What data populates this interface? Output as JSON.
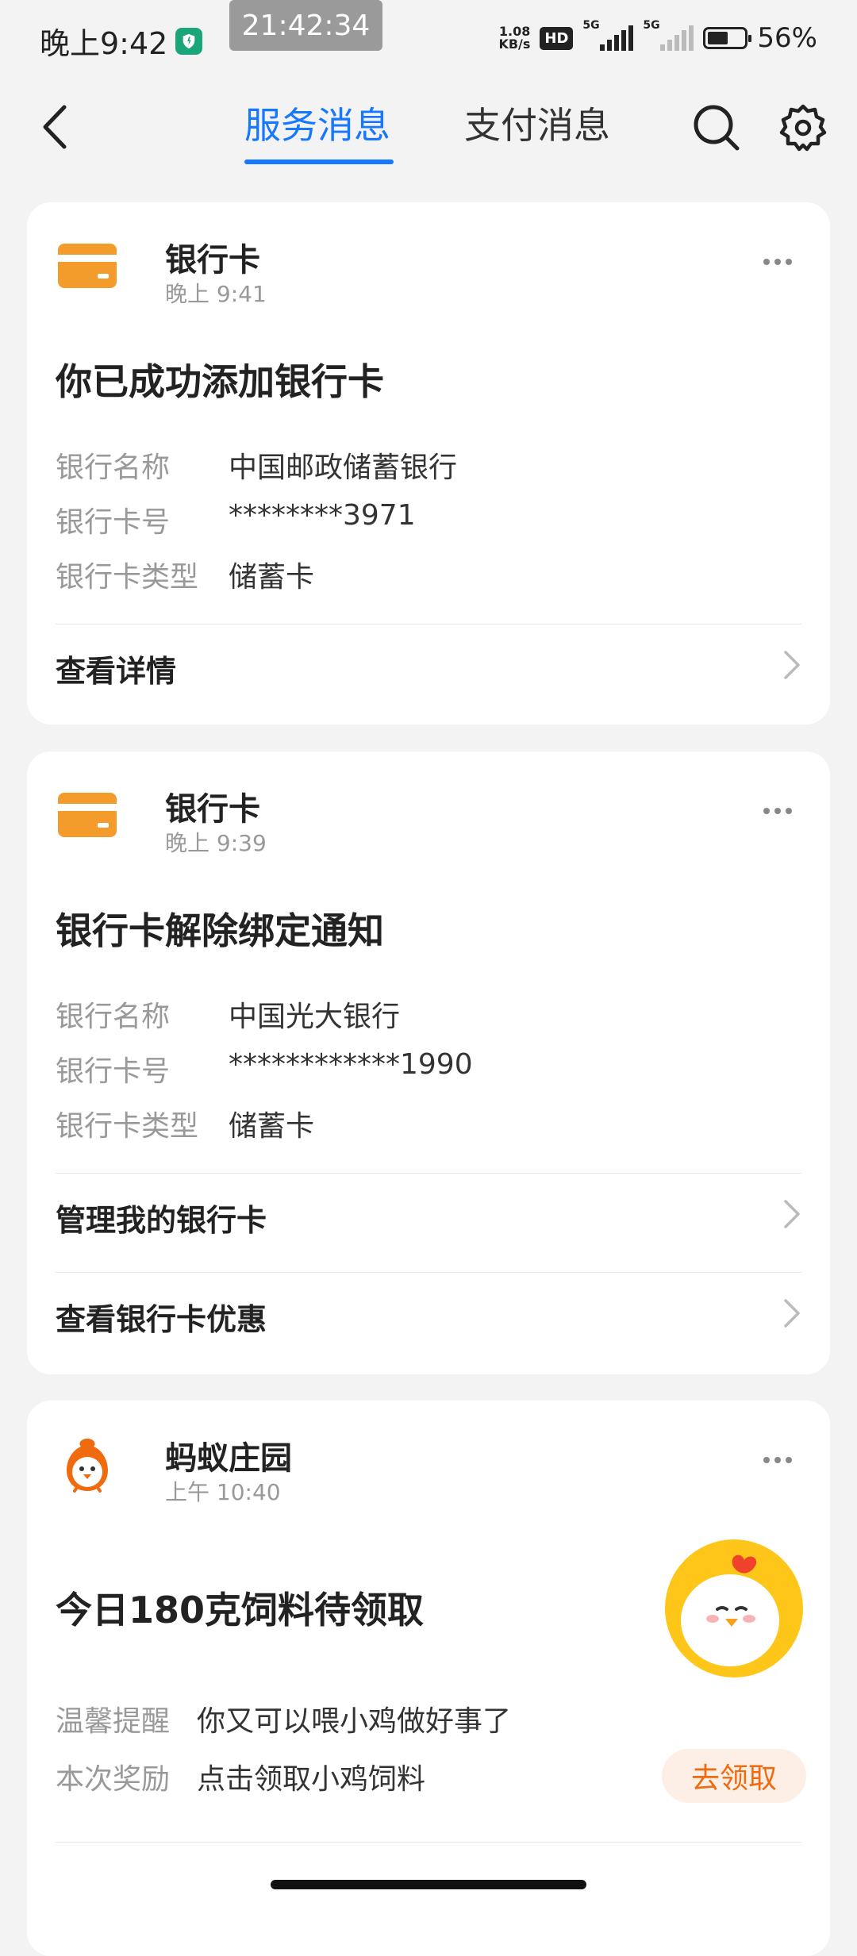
{
  "status_bar": {
    "time": "晚上9:42",
    "clock_pill": "21:42:34",
    "net_speed_value": "1.08",
    "net_speed_unit": "KB/s",
    "hd_badge": "HD",
    "sim1_label": "5G",
    "sim2_label": "5G",
    "battery_percent": 56,
    "battery_text": "56%"
  },
  "header": {
    "tabs": [
      {
        "label": "服务消息",
        "active": true
      },
      {
        "label": "支付消息",
        "active": false
      }
    ],
    "accent_color": "#1677ff"
  },
  "cards": [
    {
      "app_name": "银行卡",
      "time": "晚上 9:41",
      "title": "你已成功添加银行卡",
      "fields": [
        {
          "key": "银行名称",
          "value": "中国邮政储蓄银行"
        },
        {
          "key": "银行卡号",
          "value": "********3971"
        },
        {
          "key": "银行卡类型",
          "value": "储蓄卡"
        }
      ],
      "actions": [
        "查看详情"
      ]
    },
    {
      "app_name": "银行卡",
      "time": "晚上 9:39",
      "title": "银行卡解除绑定通知",
      "fields": [
        {
          "key": "银行名称",
          "value": "中国光大银行"
        },
        {
          "key": "银行卡号",
          "value": "************1990"
        },
        {
          "key": "银行卡类型",
          "value": "储蓄卡"
        }
      ],
      "actions": [
        "管理我的银行卡",
        "查看银行卡优惠"
      ]
    },
    {
      "app_name": "蚂蚁庄园",
      "time": "上午 10:40",
      "title": "今日180克饲料待领取",
      "fields": [
        {
          "key": "温馨提醒",
          "value": "你又可以喂小鸡做好事了"
        },
        {
          "key": "本次奖励",
          "value": "点击领取小鸡饲料"
        }
      ],
      "claim_button": "去领取"
    }
  ],
  "colors": {
    "bank_icon": "#f39c2b",
    "farm_orange": "#f06a0f",
    "background": "#f3f3f3"
  }
}
